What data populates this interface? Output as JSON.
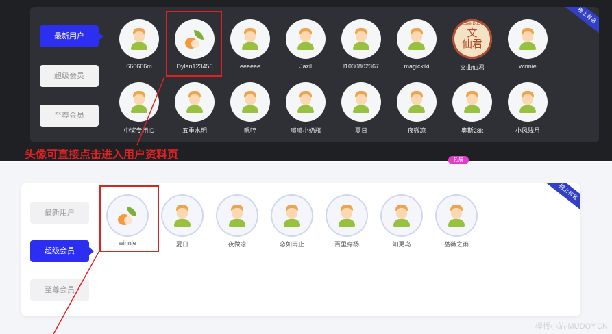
{
  "top": {
    "corner_label": "榜上有名",
    "tabs": [
      {
        "label": "最新用户",
        "active": true
      },
      {
        "label": "超级会员",
        "active": false
      },
      {
        "label": "至尊会员",
        "active": false
      }
    ],
    "row1": [
      {
        "name": "666666m",
        "avatar": "boy"
      },
      {
        "name": "Dylan123456",
        "avatar": "leaf"
      },
      {
        "name": "eeeeee",
        "avatar": "boy"
      },
      {
        "name": "Jazil",
        "avatar": "boy"
      },
      {
        "name": "l1030802367",
        "avatar": "boy"
      },
      {
        "name": "magickiki",
        "avatar": "boy"
      },
      {
        "name": "文曲仙君",
        "avatar": "stamp",
        "stamp_top": "Love Duck",
        "stamp_text": "文\n仙君"
      },
      {
        "name": "winnie",
        "avatar": "boy"
      }
    ],
    "row2": [
      {
        "name": "中奖专用ID",
        "avatar": "boy"
      },
      {
        "name": "五重水明",
        "avatar": "boy"
      },
      {
        "name": "嗯哼",
        "avatar": "boy"
      },
      {
        "name": "嘟嘟小奶瓶",
        "avatar": "boy"
      },
      {
        "name": "夏日",
        "avatar": "boy"
      },
      {
        "name": "夜微凉",
        "avatar": "boy"
      },
      {
        "name": "奥斯28k",
        "avatar": "boy"
      },
      {
        "name": "小风残月",
        "avatar": "boy"
      }
    ]
  },
  "annotation_text": "头像可直接点击进入用户资料页",
  "badge_text": "拓展",
  "bottom": {
    "corner_label": "榜上有名",
    "tabs": [
      {
        "label": "最新用户",
        "active": false
      },
      {
        "label": "超级会员",
        "active": true
      },
      {
        "label": "至尊会员",
        "active": false
      }
    ],
    "row1": [
      {
        "name": "winnie",
        "avatar": "leaf"
      },
      {
        "name": "夏日",
        "avatar": "boy"
      },
      {
        "name": "夜微凉",
        "avatar": "boy"
      },
      {
        "name": "恋如雨止",
        "avatar": "boy"
      },
      {
        "name": "百里穿杨",
        "avatar": "boy"
      },
      {
        "name": "知更鸟",
        "avatar": "boy"
      },
      {
        "name": "蔷薇之雨",
        "avatar": "boy"
      }
    ]
  },
  "watermark": "模板小站-MUDOY.CN",
  "colors": {
    "accent": "#2d2ff0",
    "highlight": "#e12121",
    "dark_panel": "#2f3035"
  }
}
